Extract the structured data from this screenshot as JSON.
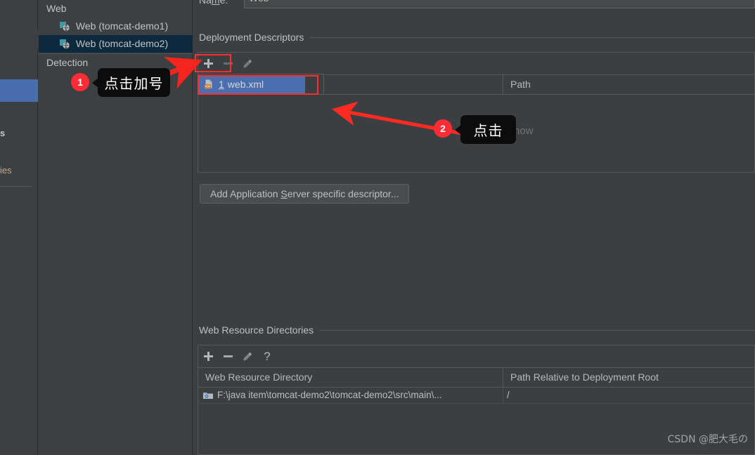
{
  "colors": {
    "window_bg": "#3c3f41",
    "panel_bg": "#3c4043",
    "tree_selection": "#0d293e",
    "popup_selection": "#4b6eaf",
    "left_panel_selection": "#4a6daf",
    "annotation_red": "#ff2d2d",
    "badge_red": "#fb2c36",
    "tooltip_bg": "#0c0c0c",
    "border": "#55585a",
    "text": "#bbbbbb",
    "muted_text": "#6f7376"
  },
  "far_left_panel": {
    "partial_label_top": "s",
    "partial_label_bottom": "ies"
  },
  "tree": {
    "items": [
      {
        "label": "Web",
        "level": 0,
        "icon": "none",
        "selected": false
      },
      {
        "label": "Web (tomcat-demo1)",
        "level": 1,
        "icon": "web-artifact-icon",
        "selected": false
      },
      {
        "label": "Web (tomcat-demo2)",
        "level": 1,
        "icon": "web-artifact-icon",
        "selected": true
      },
      {
        "label": "Detection",
        "level": 0,
        "icon": "none",
        "selected": false
      }
    ]
  },
  "name_field": {
    "label_before": "Na",
    "label_mnemonic": "m",
    "label_after": "e:",
    "value": "Web"
  },
  "deployment_descriptors": {
    "section_title": "Deployment Descriptors",
    "toolbar": {
      "add": "add-icon",
      "remove": "remove-icon",
      "edit": "edit-icon"
    },
    "columns": [
      "",
      "Path"
    ],
    "empty_message": "Nothing to show",
    "add_server_descriptor_button": {
      "before": "Add Application ",
      "mnemonic": "S",
      "after": "erver specific descriptor..."
    }
  },
  "descriptor_popup": {
    "items": [
      {
        "mnemonic": "1",
        "label": "web.xml",
        "icon": "xml-file-icon",
        "selected": true
      }
    ]
  },
  "web_resource_directories": {
    "section_title": "Web Resource Directories",
    "toolbar": {
      "add": "add-icon",
      "remove": "remove-icon",
      "edit": "edit-icon",
      "help": "help-icon"
    },
    "columns": [
      "Web Resource Directory",
      "Path Relative to Deployment Root"
    ],
    "rows": [
      {
        "directory": "F:\\java item\\tomcat-demo2\\tomcat-demo2\\src\\main\\...",
        "path": "/",
        "icon": "folder-icon"
      }
    ]
  },
  "annotations": [
    {
      "badge": "1",
      "tip": "点击加号"
    },
    {
      "badge": "2",
      "tip": "点击"
    }
  ],
  "watermark": "CSDN @肥大毛の"
}
